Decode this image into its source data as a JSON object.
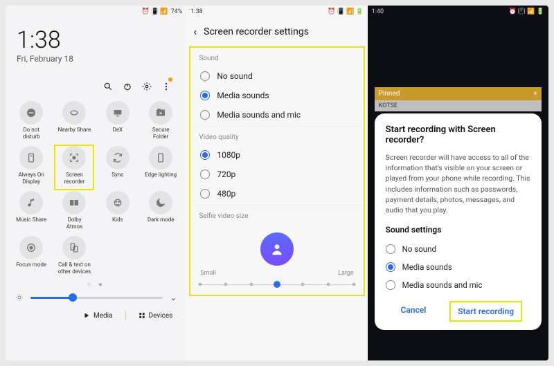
{
  "panel1": {
    "status": {
      "battery": "74%",
      "icons": "⏰ 📳 📶"
    },
    "clock": {
      "time": "1:38",
      "date": "Fri, February 18"
    },
    "action_icons": [
      "search-icon",
      "power-icon",
      "gear-icon",
      "more-icon"
    ],
    "tiles": [
      {
        "key": "dnd",
        "label": "Do not\ndisturb"
      },
      {
        "key": "nearby",
        "label": "Nearby Share"
      },
      {
        "key": "dex",
        "label": "DeX"
      },
      {
        "key": "securefolder",
        "label": "Secure\nFolder"
      },
      {
        "key": "aod",
        "label": "Always On\nDisplay"
      },
      {
        "key": "screenrec",
        "label": "Screen\nrecorder",
        "highlight": true
      },
      {
        "key": "sync",
        "label": "Sync"
      },
      {
        "key": "edgelight",
        "label": "Edge lighting"
      },
      {
        "key": "musicshare",
        "label": "Music Share"
      },
      {
        "key": "dolby",
        "label": "Dolby\nAtmos"
      },
      {
        "key": "kids",
        "label": "Kids"
      },
      {
        "key": "darkmode",
        "label": "Dark mode"
      },
      {
        "key": "focusmode",
        "label": "Focus mode"
      },
      {
        "key": "calltext",
        "label": "Call & text on\nother devices"
      }
    ],
    "brightness_percent": 32,
    "bottom": {
      "media": "Media",
      "devices": "Devices"
    }
  },
  "panel2": {
    "status_time": "1:38",
    "back": "‹",
    "title": "Screen recorder settings",
    "sections": {
      "sound": {
        "heading": "Sound",
        "options": [
          {
            "label": "No sound",
            "checked": false
          },
          {
            "label": "Media sounds",
            "checked": true
          },
          {
            "label": "Media sounds and mic",
            "checked": false
          }
        ]
      },
      "video": {
        "heading": "Video quality",
        "options": [
          {
            "label": "1080p",
            "checked": true
          },
          {
            "label": "720p",
            "checked": false
          },
          {
            "label": "480p",
            "checked": false
          }
        ]
      },
      "selfie": {
        "heading": "Selfie video size",
        "small": "Small",
        "large": "Large",
        "position_index": 3,
        "dot_count": 7
      }
    }
  },
  "panel3": {
    "status_time": "1:40",
    "pinned": {
      "label": "Pinned",
      "plus": "+"
    },
    "list_item": "KOTSE",
    "dialog": {
      "title": "Start recording with Screen recorder?",
      "body": "Screen recorder will have access to all of the information that's visible on your screen or played from your phone while recording. This includes information such as passwords, payment details, photos, messages, and audio that you play.",
      "sound_heading": "Sound settings",
      "options": [
        {
          "label": "No sound",
          "checked": false
        },
        {
          "label": "Media sounds",
          "checked": true
        },
        {
          "label": "Media sounds and mic",
          "checked": false
        }
      ],
      "cancel": "Cancel",
      "start": "Start recording"
    }
  }
}
